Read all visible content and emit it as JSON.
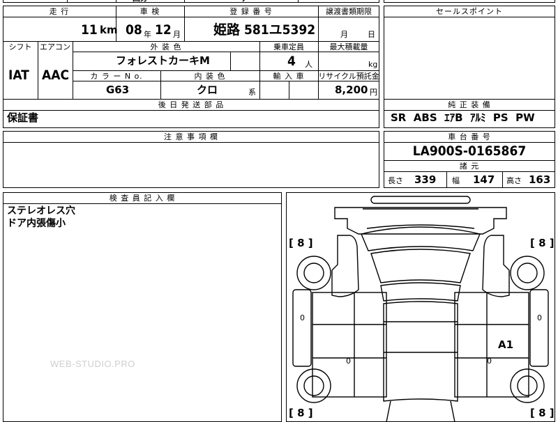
{
  "top_partial": {
    "left_fragment": "回分",
    "right_fragment": "ゲ"
  },
  "labels": {
    "mileage": "走 行",
    "inspection": "車 検",
    "registration": "登 録 番 号",
    "transfer_doc": "譲渡書類期限",
    "sales_point": "セールスポイント",
    "shift": "シフト",
    "aircon": "エアコン",
    "exterior_color": "外 装 色",
    "capacity": "乗車定員",
    "max_load": "最大積載量",
    "color_no": "カ ラ ー  N o.",
    "interior_color": "内 装 色",
    "import": "輸 入 車",
    "recycle": "リサイクル預託金",
    "shipping_parts": "後 日 発 送 部 品",
    "standard_equip": "純 正 装 備",
    "notes": "注 意 事 項 欄",
    "chassis_no": "車 台 番 号",
    "specs": "諸 元",
    "inspector_notes": "検 査 員 記 入 欄",
    "length": "長さ",
    "width": "幅",
    "height": "高さ"
  },
  "values": {
    "mileage_value": "11",
    "mileage_unit": "km",
    "inspection_year": "08",
    "inspection_year_unit": "年",
    "inspection_month": "12",
    "inspection_month_unit": "月",
    "registration": "姫路 581ユ5392",
    "transfer_month_unit": "月",
    "transfer_day_unit": "日",
    "shift": "IAT",
    "aircon": "AAC",
    "exterior_color": "フォレストカーキM",
    "capacity": "4",
    "capacity_unit": "人",
    "max_load_unit": "kg",
    "color_no": "G63",
    "interior_color": "クロ",
    "interior_suffix": "系",
    "recycle": "8,200",
    "recycle_unit": "円",
    "shipping_parts": "保証書",
    "standard_equip": "SR  ABS  ｴｱB  ｱﾙﾐ  PS  PW",
    "chassis_no": "LA900S-0165867",
    "length": "339",
    "width": "147",
    "height": "163",
    "inspector_line1": "ステレオレス穴",
    "inspector_line2": "ドア内張傷小"
  },
  "diagram": {
    "tire_marks": [
      "[ 8 ]",
      "[ 8 ]",
      "[ 8 ]",
      "[ 8 ]"
    ],
    "damage_code": "A1",
    "dents": [
      "0",
      "0",
      "0",
      "0"
    ]
  },
  "watermark": "WEB-STUDIO.PRO"
}
